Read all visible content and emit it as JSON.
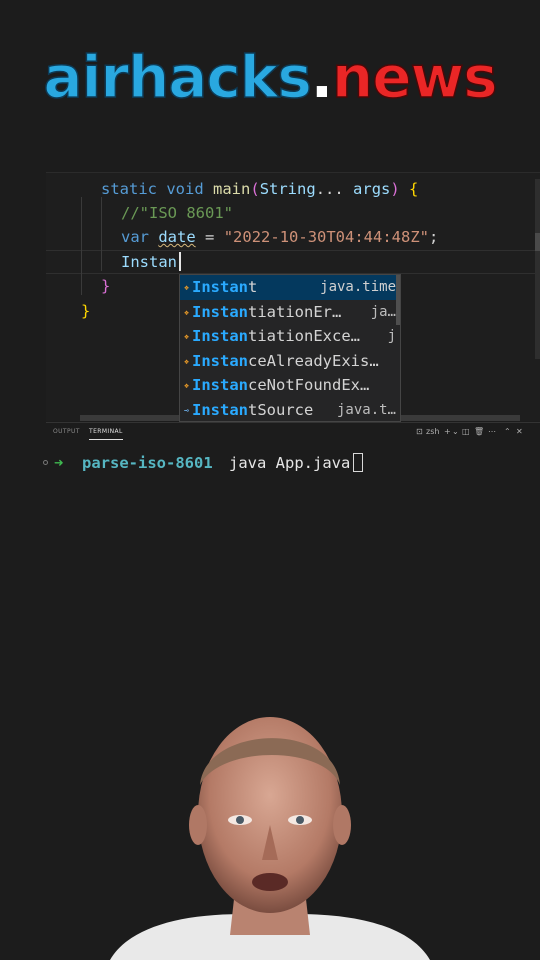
{
  "brand": {
    "part1": "airhacks",
    "part2": ".",
    "part3": "news"
  },
  "editor": {
    "lines": [
      {
        "t1": "static",
        "t2": "void",
        "t3": "main",
        "t4": "(",
        "t5": "String",
        "t6": "...",
        "t7": "args",
        "t8": ")",
        "t9": "{"
      },
      {
        "comment": "//\"ISO 8601\""
      },
      {
        "kw": "var",
        "name": "date",
        "op": "=",
        "str": "\"2022-10-30T04:44:48Z\"",
        "end": ";"
      },
      {
        "typed": "Instan"
      },
      {
        "brace": "}"
      },
      {
        "brace": "}"
      }
    ]
  },
  "suggest": {
    "items": [
      {
        "match": "Instan",
        "rest": "t",
        "detail": "java.time",
        "icon": "class-icon"
      },
      {
        "match": "Instan",
        "rest": "tiationEr…",
        "detail": "ja…",
        "icon": "class-icon"
      },
      {
        "match": "Instan",
        "rest": "tiationExce…",
        "detail": "j",
        "icon": "class-icon"
      },
      {
        "match": "Instan",
        "rest": "ceAlreadyExis…",
        "detail": "",
        "icon": "class-icon"
      },
      {
        "match": "Instan",
        "rest": "ceNotFoundEx…",
        "detail": "",
        "icon": "class-icon"
      },
      {
        "match": "Instan",
        "rest": "tSource",
        "detail": "java.t…",
        "icon": "interface-icon"
      }
    ]
  },
  "panel": {
    "tabs": [
      "OUTPUT",
      "TERMINAL"
    ],
    "active_tab": "TERMINAL",
    "shell": "zsh",
    "actions": [
      "terminal-icon",
      "add-icon",
      "split-icon",
      "trash-icon",
      "more-icon",
      "maximize-icon",
      "close-icon"
    ]
  },
  "terminal": {
    "prompt_arrow": "➜",
    "dir": "parse-iso-8601",
    "command": "java App.java"
  },
  "colors": {
    "brand_blue": "#29a8e0",
    "brand_red": "#ea2626",
    "keyword": "#569cd6",
    "string": "#ce9178",
    "comment": "#6a9955",
    "match": "#2aaaff",
    "prompt_green": "#3fb950",
    "dir_cyan": "#56b6c2"
  }
}
